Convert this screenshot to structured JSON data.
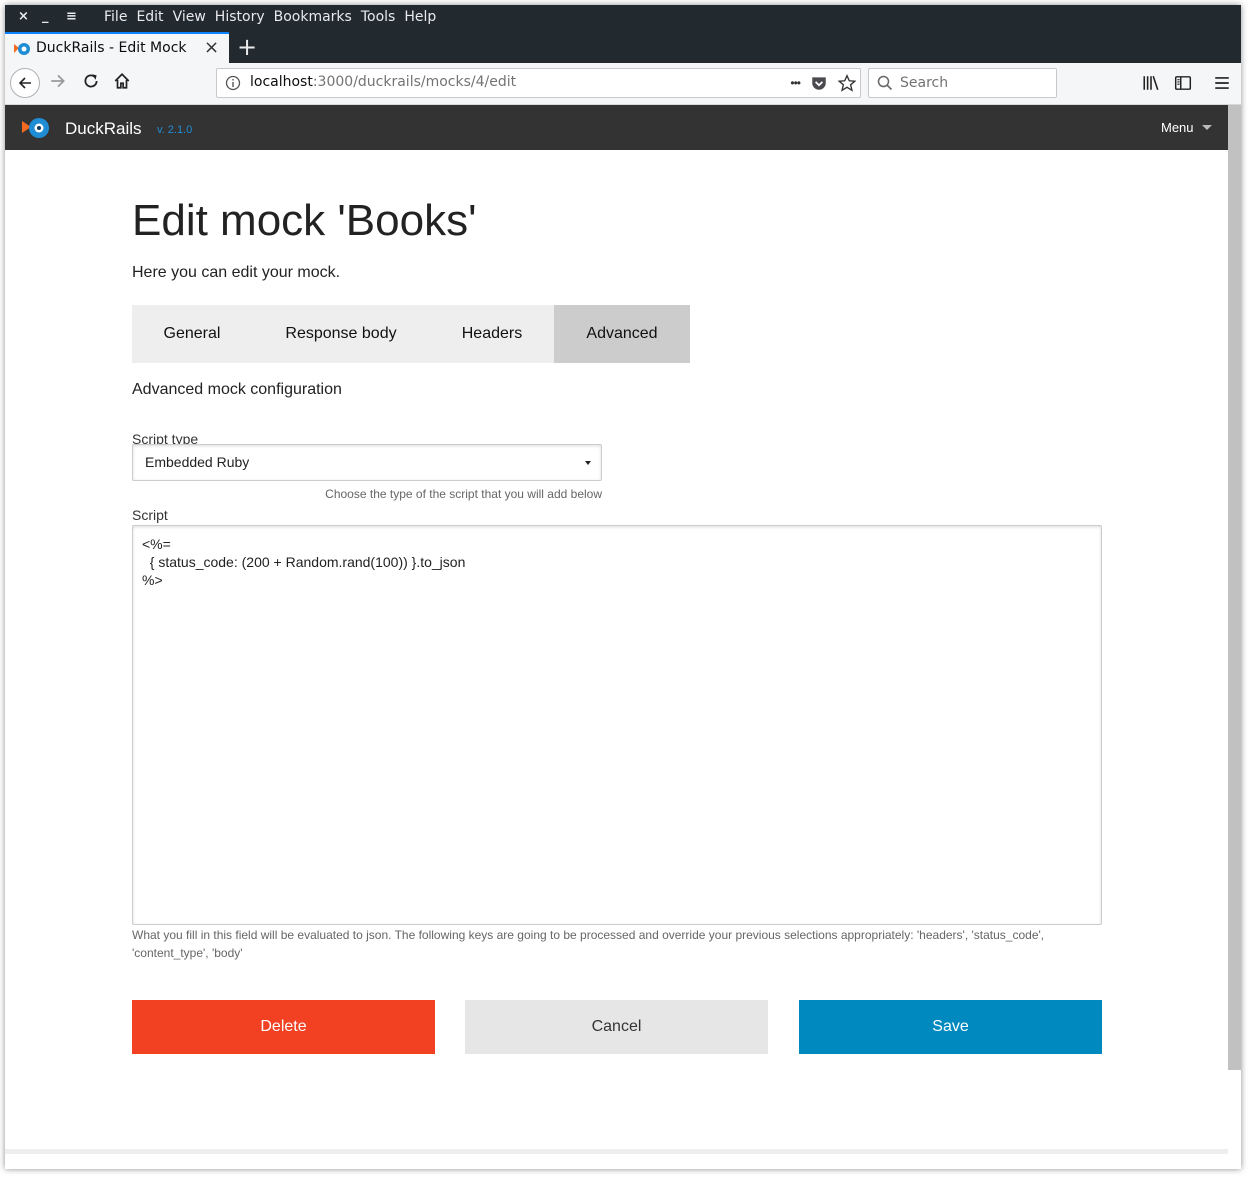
{
  "window_controls": {
    "close": "×",
    "minimize": "_",
    "maximize": "≡"
  },
  "menu": [
    "File",
    "Edit",
    "View",
    "History",
    "Bookmarks",
    "Tools",
    "Help"
  ],
  "browser_tab": {
    "title": "DuckRails - Edit Mock",
    "close": "×",
    "new_tab": "+"
  },
  "url": {
    "host": "localhost",
    "rest": ":3000/duckrails/mocks/4/edit",
    "actions_dots": "•••"
  },
  "search": {
    "placeholder": "Search"
  },
  "app": {
    "brand": "DuckRails",
    "version": "v. 2.1.0",
    "menu_label": "Menu"
  },
  "page": {
    "title": "Edit mock 'Books'",
    "subtitle": "Here you can edit your mock.",
    "tabs": [
      {
        "label": "General",
        "active": false
      },
      {
        "label": "Response body",
        "active": false
      },
      {
        "label": "Headers",
        "active": false
      },
      {
        "label": "Advanced",
        "active": true
      }
    ],
    "section_title": "Advanced mock configuration",
    "script_type": {
      "label": "Script type",
      "value": "Embedded Ruby",
      "hint": "Choose the type of the script that you will add below"
    },
    "script": {
      "label": "Script",
      "value": "<%=\n  { status_code: (200 + Random.rand(100)) }.to_json\n%>",
      "help": "What you fill in this field will be evaluated to json. The following keys are going to be processed and override your previous selections appropriately: 'headers', 'status_code', 'content_type', 'body'"
    },
    "buttons": {
      "delete": "Delete",
      "cancel": "Cancel",
      "save": "Save"
    }
  },
  "colors": {
    "delete": "#f24022",
    "cancel": "#e6e6e6",
    "save": "#0089bf",
    "appbar": "#333333",
    "active_tab": "#cccccc"
  }
}
